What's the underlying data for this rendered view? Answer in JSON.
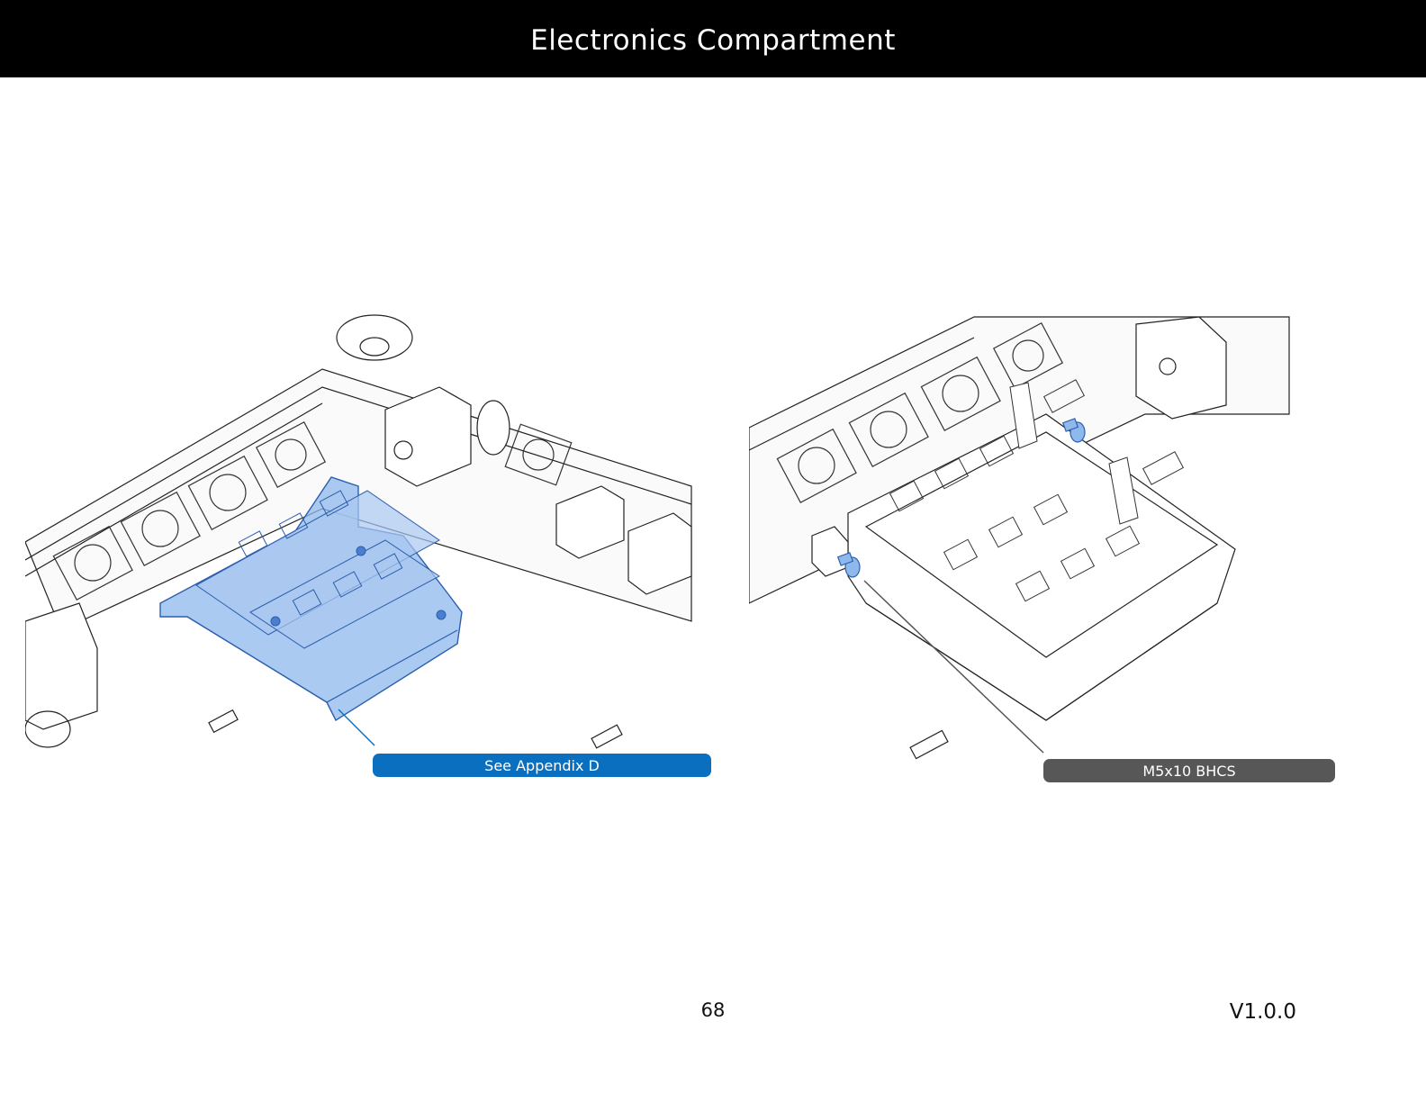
{
  "header": {
    "title": "Electronics Compartment",
    "background": "#000000",
    "text_color": "#ffffff"
  },
  "figures": [
    {
      "callout": {
        "label": "See Appendix D",
        "color": "#0a6fbf"
      },
      "highlight_color": "#8fb8ec"
    },
    {
      "callout": {
        "label": "M5x10 BHCS",
        "color": "#575757"
      },
      "highlight_color": "#8fb8ec"
    }
  ],
  "footer": {
    "page_number": "68",
    "version": "V1.0.0"
  }
}
